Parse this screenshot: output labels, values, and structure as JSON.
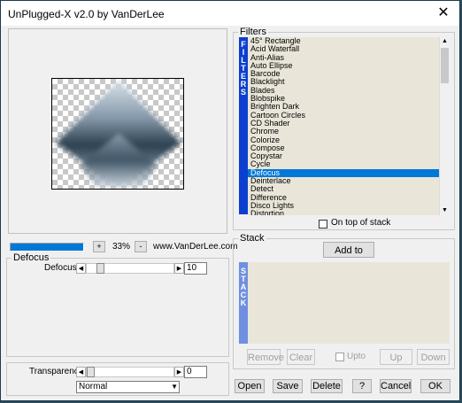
{
  "window": {
    "title": "UnPlugged-X v2.0 by VanDerLee",
    "close_glyph": "✕"
  },
  "preview": {
    "zoom_label": "33%",
    "zoom_plus": "+",
    "zoom_minus": "-",
    "website": "www.VanDerLee.com",
    "progress_fraction": 1.0
  },
  "params": {
    "group_label": "Defocus",
    "defocus_label": "Defocus",
    "defocus_value": "10",
    "defocus_fraction": 0.12
  },
  "blend": {
    "transparency_label": "Transparency",
    "transparency_value": "0",
    "transparency_fraction": 0.0,
    "mode_value": "Normal"
  },
  "filters": {
    "group_label": "Filters",
    "tab_label": "F\nI\nL\nT\nE\nR\nS",
    "items": [
      "45° Rectangle",
      "Acid Waterfall",
      "Anti-Alias",
      "Auto Ellipse",
      "Barcode",
      "Blacklight",
      "Blades",
      "Blobspike",
      "Brighten Dark",
      "Cartoon Circles",
      "CD Shader",
      "Chrome",
      "Colorize",
      "Compose",
      "Copystar",
      "Cycle",
      "Defocus",
      "Deinterlace",
      "Detect",
      "Difference",
      "Disco Lights",
      "Distortion"
    ],
    "selected_index": 16,
    "on_top_label": "On top of stack"
  },
  "stack": {
    "group_label": "Stack",
    "add_button": "Add to stack",
    "tab_label": "S\nT\nA\nC\nK",
    "remove_button": "Remove",
    "clear_button": "Clear",
    "upto_label": "Upto",
    "up_button": "Up",
    "down_button": "Down"
  },
  "footer": {
    "open": "Open",
    "save": "Save",
    "delete": "Delete",
    "help": "?",
    "cancel": "Cancel",
    "ok": "OK"
  },
  "colors": {
    "accent": "#0b3fd0",
    "selection": "#0078d7",
    "list_bg": "#e9e6d9",
    "stack_tab": "#6f8fe0"
  }
}
